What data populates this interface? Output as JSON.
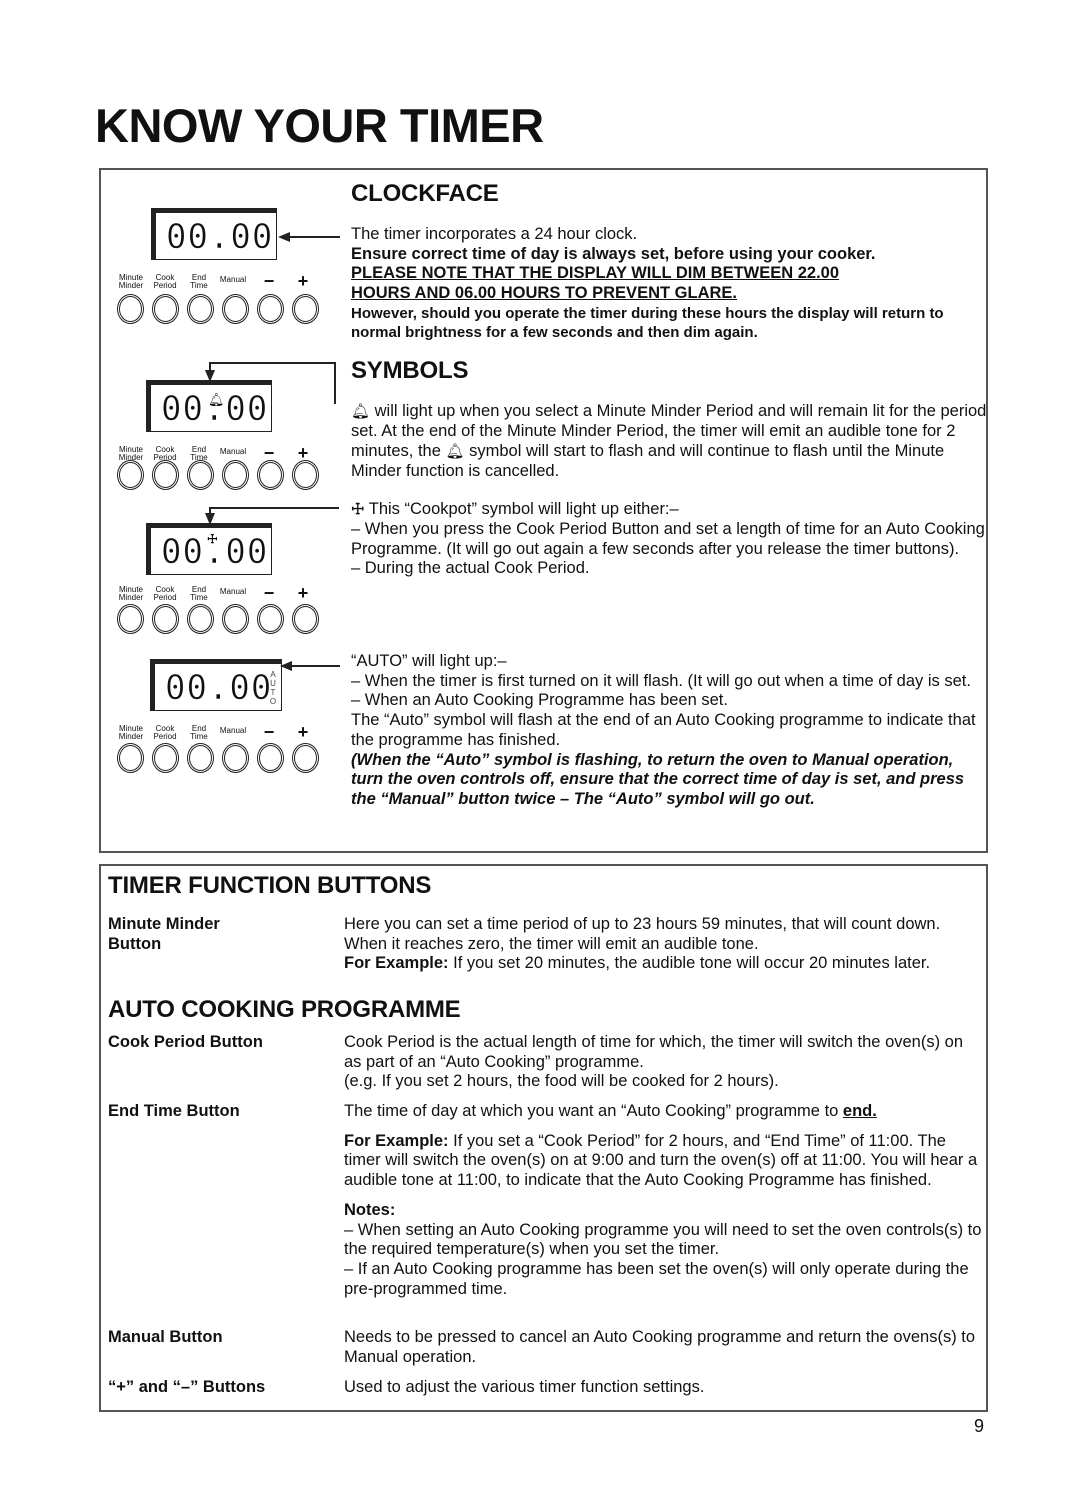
{
  "page": {
    "title": "KNOW YOUR TIMER",
    "page_number": "9"
  },
  "timer_panel": {
    "display_time": "00.00",
    "buttons": [
      {
        "label": "Minute Minder",
        "line1": "Minute",
        "line2": "Minder"
      },
      {
        "label": "Cook Period",
        "line1": "Cook",
        "line2": "Period"
      },
      {
        "label": "End Time",
        "line1": "End",
        "line2": "Time"
      },
      {
        "label": "Manual",
        "line1": "Manual",
        "line2": ""
      },
      {
        "label": "−",
        "line1": "−",
        "line2": ""
      },
      {
        "label": "+",
        "line1": "+",
        "line2": ""
      }
    ],
    "auto_letters": [
      "A",
      "U",
      "T",
      "O"
    ],
    "icons": {
      "bell": "bell-icon",
      "cookpot": "cookpot-icon"
    }
  },
  "clockface": {
    "heading": "CLOCKFACE",
    "line1": "The timer incorporates a 24 hour clock.",
    "line2": "Ensure correct time of day is always set, before using your cooker.",
    "note_underlined_1": "PLEASE NOTE THAT THE DISPLAY WILL DIM BETWEEN 22.00",
    "note_underlined_2": "HOURS AND 06.00 HOURS TO PREVENT GLARE.",
    "note_bold": "However, should you operate the timer during these hours the display will return to normal brightness for a few seconds and then dim again."
  },
  "symbols": {
    "heading": "SYMBOLS",
    "bell_para_a": " will light up when you select a Minute Minder Period and will remain lit for the period set. At the end of the Minute Minder Period, the timer will emit an audible tone for 2 minutes, the ",
    "bell_para_b": " symbol will start to flash and will continue to flash until the Minute Minder function is cancelled.",
    "cookpot_intro": " This “Cookpot” symbol will light up either:–",
    "cookpot_item1": "– When you press the Cook Period Button and set a length of time for an Auto Cooking Programme. (It will go out again a few seconds after you release the timer buttons).",
    "cookpot_item2": "– During the actual Cook Period.",
    "auto_intro": "“AUTO” will light up:–",
    "auto_item1": "– When the timer is first turned on it will flash. (It will go out when a time of day is set.",
    "auto_item2": "– When an Auto Cooking Programme has been set.",
    "auto_flash": "The “Auto” symbol will flash at the end of an Auto Cooking programme to indicate that the programme has finished.",
    "auto_note": "(When the “Auto” symbol is flashing, to return the oven to Manual operation, turn the oven controls off, ensure that the correct time of day is set, and press the “Manual” button twice – The “Auto” symbol will go out."
  },
  "timer_function_buttons": {
    "heading": "TIMER FUNCTION BUTTONS",
    "minute_minder": {
      "label_line1": "Minute Minder",
      "label_line2": "Button",
      "desc": "Here you can set a time period of up to 23 hours 59 minutes, that will count down. When it reaches zero, the timer will emit an audible tone.",
      "example_label": "For Example:",
      "example_text": " If you set 20 minutes, the audible tone will occur 20 minutes later."
    }
  },
  "auto_cooking": {
    "heading": "AUTO COOKING PROGRAMME",
    "cook_period": {
      "label": "Cook Period Button",
      "desc": "Cook Period is the actual length of time for which, the timer will switch the oven(s) on as part of an “Auto Cooking” programme.",
      "desc2": "(e.g. If you set 2 hours, the food will be cooked for 2 hours)."
    },
    "end_time": {
      "label": "End Time Button",
      "desc_a": "The time of day at which you want an “Auto Cooking” programme to ",
      "desc_end": "end.",
      "example_label": "For Example:",
      "example_text": " If you set a “Cook Period” for 2 hours, and “End Time” of 11:00. The timer will switch the oven(s) on at 9:00 and turn the oven(s) off at 11:00. You will hear a audible tone at 11:00, to indicate that the Auto Cooking Programme has finished.",
      "notes_label": "Notes:",
      "note1": "– When setting an Auto Cooking programme you will need to set the oven controls(s) to the required temperature(s) when you set the timer.",
      "note2": "– If an Auto Cooking programme has been set the oven(s) will only operate during the pre-programmed time."
    },
    "manual": {
      "label": "Manual Button",
      "desc": "Needs to be pressed to cancel an Auto Cooking programme and return the ovens(s) to Manual operation."
    },
    "plus_minus": {
      "label": "“+” and “–” Buttons",
      "desc": "Used to adjust the various timer function settings."
    }
  }
}
